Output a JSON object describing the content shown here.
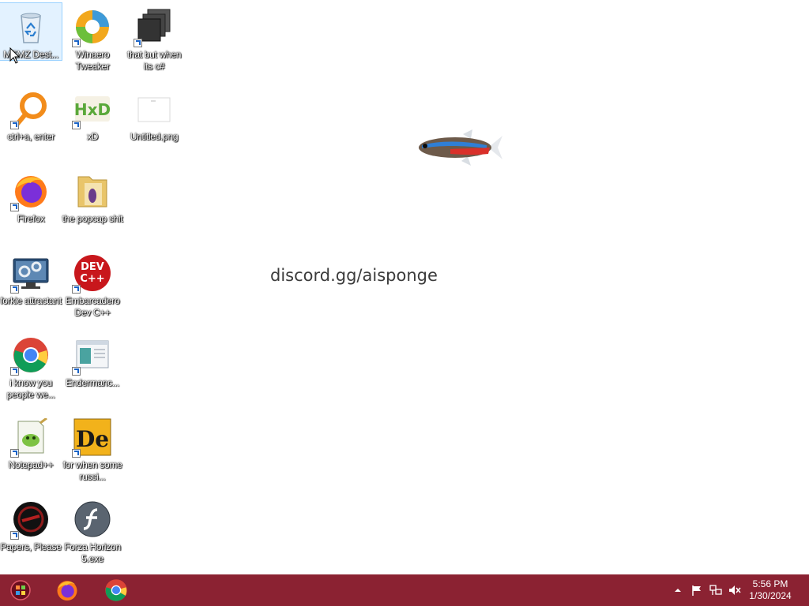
{
  "desktop": {
    "icons": [
      {
        "label": "MEMZ Dest...",
        "icon": "recycle-bin-icon"
      },
      {
        "label": "Winaero Tweaker",
        "icon": "winaero-icon"
      },
      {
        "label": "that but when its c#",
        "icon": "stacked-windows-icon"
      },
      {
        "label": "ctrl+a, enter",
        "icon": "orange-magnifier-icon"
      },
      {
        "label": "xD",
        "icon": "hxd-icon"
      },
      {
        "label": "Untitled.png",
        "icon": "image-file-icon"
      },
      {
        "label": "Firefox",
        "icon": "firefox-icon"
      },
      {
        "label": "the popcap shit",
        "icon": "folder-icon"
      },
      {
        "label": "forkie attractant",
        "icon": "monitor-gear-icon"
      },
      {
        "label": "Embarcadero Dev C++",
        "icon": "devcpp-icon"
      },
      {
        "label": "i know you people we...",
        "icon": "chrome-icon"
      },
      {
        "label": "Endermanc...",
        "icon": "window-app-icon"
      },
      {
        "label": "Notepad++",
        "icon": "notepadpp-icon"
      },
      {
        "label": "for when some russi...",
        "icon": "de-icon"
      },
      {
        "label": "Papers, Please",
        "icon": "papers-please-icon"
      },
      {
        "label": "Forza Horizon 5.exe",
        "icon": "flash-icon"
      }
    ],
    "watermark": "discord.gg/aisponge",
    "devcpp_text_top": "DEV",
    "devcpp_text_bottom": "C++",
    "hxd_text": "HxD",
    "de_text": "De"
  },
  "taskbar": {
    "color": "#8b2232",
    "pinned": [
      "start-orb-icon",
      "firefox-icon",
      "chrome-icon"
    ],
    "tray": [
      "show-hidden-icons-chevron",
      "action-center-flag-icon",
      "network-icon",
      "volume-muted-icon"
    ],
    "time": "5:56 PM",
    "date": "1/30/2024"
  }
}
